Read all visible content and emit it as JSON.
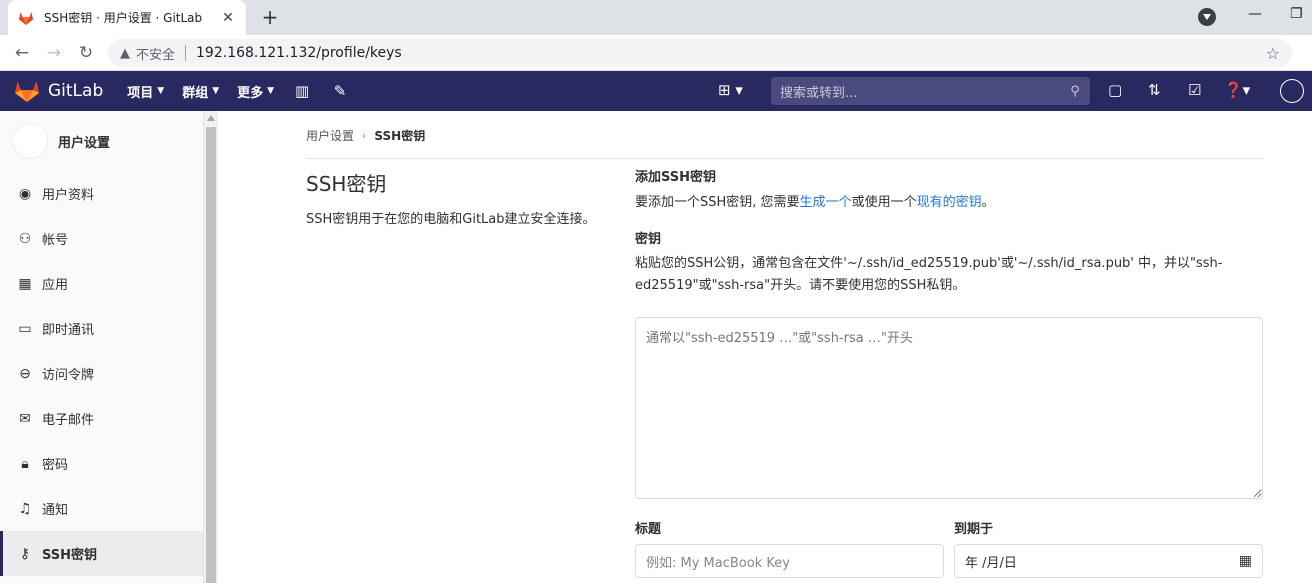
{
  "browser": {
    "tab_title": "SSH密钥 · 用户设置 · GitLab",
    "security_label": "不安全",
    "url": "192.168.121.132/profile/keys"
  },
  "gitlab_nav": {
    "brand": "GitLab",
    "menu": [
      "项目",
      "群组",
      "更多"
    ],
    "search_placeholder": "搜索或转到..."
  },
  "sidebar": {
    "title": "用户设置",
    "items": [
      {
        "label": "用户资料",
        "icon": "profile-icon"
      },
      {
        "label": "帐号",
        "icon": "account-icon"
      },
      {
        "label": "应用",
        "icon": "applications-icon"
      },
      {
        "label": "即时通讯",
        "icon": "chat-icon"
      },
      {
        "label": "访问令牌",
        "icon": "token-icon"
      },
      {
        "label": "电子邮件",
        "icon": "email-icon"
      },
      {
        "label": "密码",
        "icon": "lock-icon"
      },
      {
        "label": "通知",
        "icon": "bell-icon"
      },
      {
        "label": "SSH密钥",
        "icon": "key-icon",
        "active": true
      }
    ]
  },
  "breadcrumb": {
    "parent": "用户设置",
    "current": "SSH密钥"
  },
  "section": {
    "title": "SSH密钥",
    "description": "SSH密钥用于在您的电脑和GitLab建立安全连接。"
  },
  "add_key": {
    "heading": "添加SSH密钥",
    "intro_prefix": "要添加一个SSH密钥, 您需要",
    "link_generate": "生成一个",
    "intro_middle": "或使用一个",
    "link_existing": "现有的密钥",
    "intro_suffix": "。",
    "key_label": "密钥",
    "key_help": "粘贴您的SSH公钥，通常包含在文件'~/.ssh/id_ed25519.pub'或'~/.ssh/id_rsa.pub' 中，并以\"ssh-ed25519\"或\"ssh-rsa\"开头。请不要使用您的SSH私钥。",
    "key_placeholder": "通常以\"ssh-ed25519 …\"或\"ssh-rsa …\"开头",
    "title_label": "标题",
    "title_placeholder": "例如: My MacBook Key",
    "expires_label": "到期于",
    "expires_value": "年 /月/日"
  }
}
